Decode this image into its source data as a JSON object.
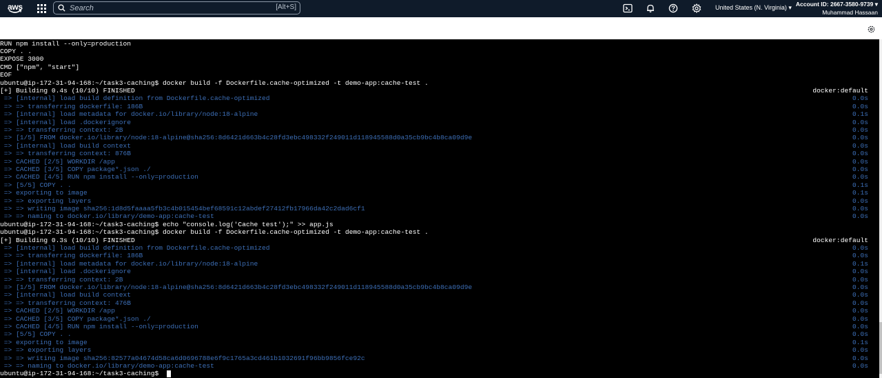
{
  "topbar": {
    "logo": "aws",
    "search_placeholder": "Search",
    "search_shortcut": "[Alt+S]",
    "region": "United States (N. Virginia) ▾",
    "account_id": "Account ID: 2667-3580-9739 ▾",
    "user": "Muhammad Hassaan",
    "icons": [
      "apps-grid-icon",
      "search-icon",
      "cloudshell-icon",
      "bell-icon",
      "help-icon",
      "gear-icon"
    ]
  },
  "colors": {
    "topbar_bg": "#0f1b2a",
    "terminal_bg": "#000000",
    "output_dim": "#3d6fb7",
    "text": "#ffffff"
  },
  "terminal": {
    "lines": [
      {
        "text": "RUN npm install --only=production",
        "right": "",
        "style": "cmd"
      },
      {
        "text": "COPY . .",
        "right": "",
        "style": "cmd"
      },
      {
        "text": "EXPOSE 3000",
        "right": "",
        "style": "cmd"
      },
      {
        "text": "CMD [\"npm\", \"start\"]",
        "right": "",
        "style": "cmd"
      },
      {
        "text": "EOF",
        "right": "",
        "style": "cmd"
      },
      {
        "text": "ubuntu@ip-172-31-94-168:~/task3-caching$ docker build -f Dockerfile.cache-optimized -t demo-app:cache-test .",
        "right": "",
        "style": "cmd"
      },
      {
        "text": "[+] Building 0.4s (10/10) FINISHED",
        "right": "docker:default",
        "style": "cmd"
      },
      {
        "text": " => [internal] load build definition from Dockerfile.cache-optimized",
        "right": "0.0s",
        "style": "dim"
      },
      {
        "text": " => => transferring dockerfile: 186B",
        "right": "0.0s",
        "style": "dim"
      },
      {
        "text": " => [internal] load metadata for docker.io/library/node:18-alpine",
        "right": "0.1s",
        "style": "dim"
      },
      {
        "text": " => [internal] load .dockerignore",
        "right": "0.0s",
        "style": "dim"
      },
      {
        "text": " => => transferring context: 2B",
        "right": "0.0s",
        "style": "dim"
      },
      {
        "text": " => [1/5] FROM docker.io/library/node:18-alpine@sha256:8d6421d663b4c28fd3ebc498332f249011d118945588d0a35cb9bc4b8ca09d9e",
        "right": "0.0s",
        "style": "dim"
      },
      {
        "text": " => [internal] load build context",
        "right": "0.0s",
        "style": "dim"
      },
      {
        "text": " => => transferring context: 876B",
        "right": "0.0s",
        "style": "dim"
      },
      {
        "text": " => CACHED [2/5] WORKDIR /app",
        "right": "0.0s",
        "style": "dim"
      },
      {
        "text": " => CACHED [3/5] COPY package*.json ./",
        "right": "0.0s",
        "style": "dim"
      },
      {
        "text": " => CACHED [4/5] RUN npm install --only=production",
        "right": "0.0s",
        "style": "dim"
      },
      {
        "text": " => [5/5] COPY . .",
        "right": "0.1s",
        "style": "dim"
      },
      {
        "text": " => exporting to image",
        "right": "0.1s",
        "style": "dim"
      },
      {
        "text": " => => exporting layers",
        "right": "0.0s",
        "style": "dim"
      },
      {
        "text": " => => writing image sha256:1d8d5faaaa5fb3c4b015454bef68591c12abdef27412fb17966da42c2dad6cf1",
        "right": "0.0s",
        "style": "dim"
      },
      {
        "text": " => => naming to docker.io/library/demo-app:cache-test",
        "right": "0.0s",
        "style": "dim"
      },
      {
        "text": "ubuntu@ip-172-31-94-168:~/task3-caching$ echo \"console.log('Cache test');\" >> app.js",
        "right": "",
        "style": "cmd"
      },
      {
        "text": "ubuntu@ip-172-31-94-168:~/task3-caching$ docker build -f Dockerfile.cache-optimized -t demo-app:cache-test .",
        "right": "",
        "style": "cmd"
      },
      {
        "text": "[+] Building 0.3s (10/10) FINISHED",
        "right": "docker:default",
        "style": "cmd"
      },
      {
        "text": " => [internal] load build definition from Dockerfile.cache-optimized",
        "right": "0.0s",
        "style": "dim"
      },
      {
        "text": " => => transferring dockerfile: 186B",
        "right": "0.0s",
        "style": "dim"
      },
      {
        "text": " => [internal] load metadata for docker.io/library/node:18-alpine",
        "right": "0.1s",
        "style": "dim"
      },
      {
        "text": " => [internal] load .dockerignore",
        "right": "0.0s",
        "style": "dim"
      },
      {
        "text": " => => transferring context: 2B",
        "right": "0.0s",
        "style": "dim"
      },
      {
        "text": " => [1/5] FROM docker.io/library/node:18-alpine@sha256:8d6421d663b4c28fd3ebc498332f249011d118945588d0a35cb9bc4b8ca09d9e",
        "right": "0.0s",
        "style": "dim"
      },
      {
        "text": " => [internal] load build context",
        "right": "0.0s",
        "style": "dim"
      },
      {
        "text": " => => transferring context: 476B",
        "right": "0.0s",
        "style": "dim"
      },
      {
        "text": " => CACHED [2/5] WORKDIR /app",
        "right": "0.0s",
        "style": "dim"
      },
      {
        "text": " => CACHED [3/5] COPY package*.json ./",
        "right": "0.0s",
        "style": "dim"
      },
      {
        "text": " => CACHED [4/5] RUN npm install --only=production",
        "right": "0.0s",
        "style": "dim"
      },
      {
        "text": " => [5/5] COPY . .",
        "right": "0.0s",
        "style": "dim"
      },
      {
        "text": " => exporting to image",
        "right": "0.1s",
        "style": "dim"
      },
      {
        "text": " => => exporting layers",
        "right": "0.0s",
        "style": "dim"
      },
      {
        "text": " => => writing image sha256:82577a04674d58ca6d0696788e6f9c1765a3cd461b1032691f96bb9856fce92c",
        "right": "0.0s",
        "style": "dim"
      },
      {
        "text": " => => naming to docker.io/library/demo-app:cache-test",
        "right": "0.0s",
        "style": "dim"
      },
      {
        "text": "ubuntu@ip-172-31-94-168:~/task3-caching$",
        "right": "",
        "style": "cmd",
        "cursor": true
      }
    ]
  }
}
